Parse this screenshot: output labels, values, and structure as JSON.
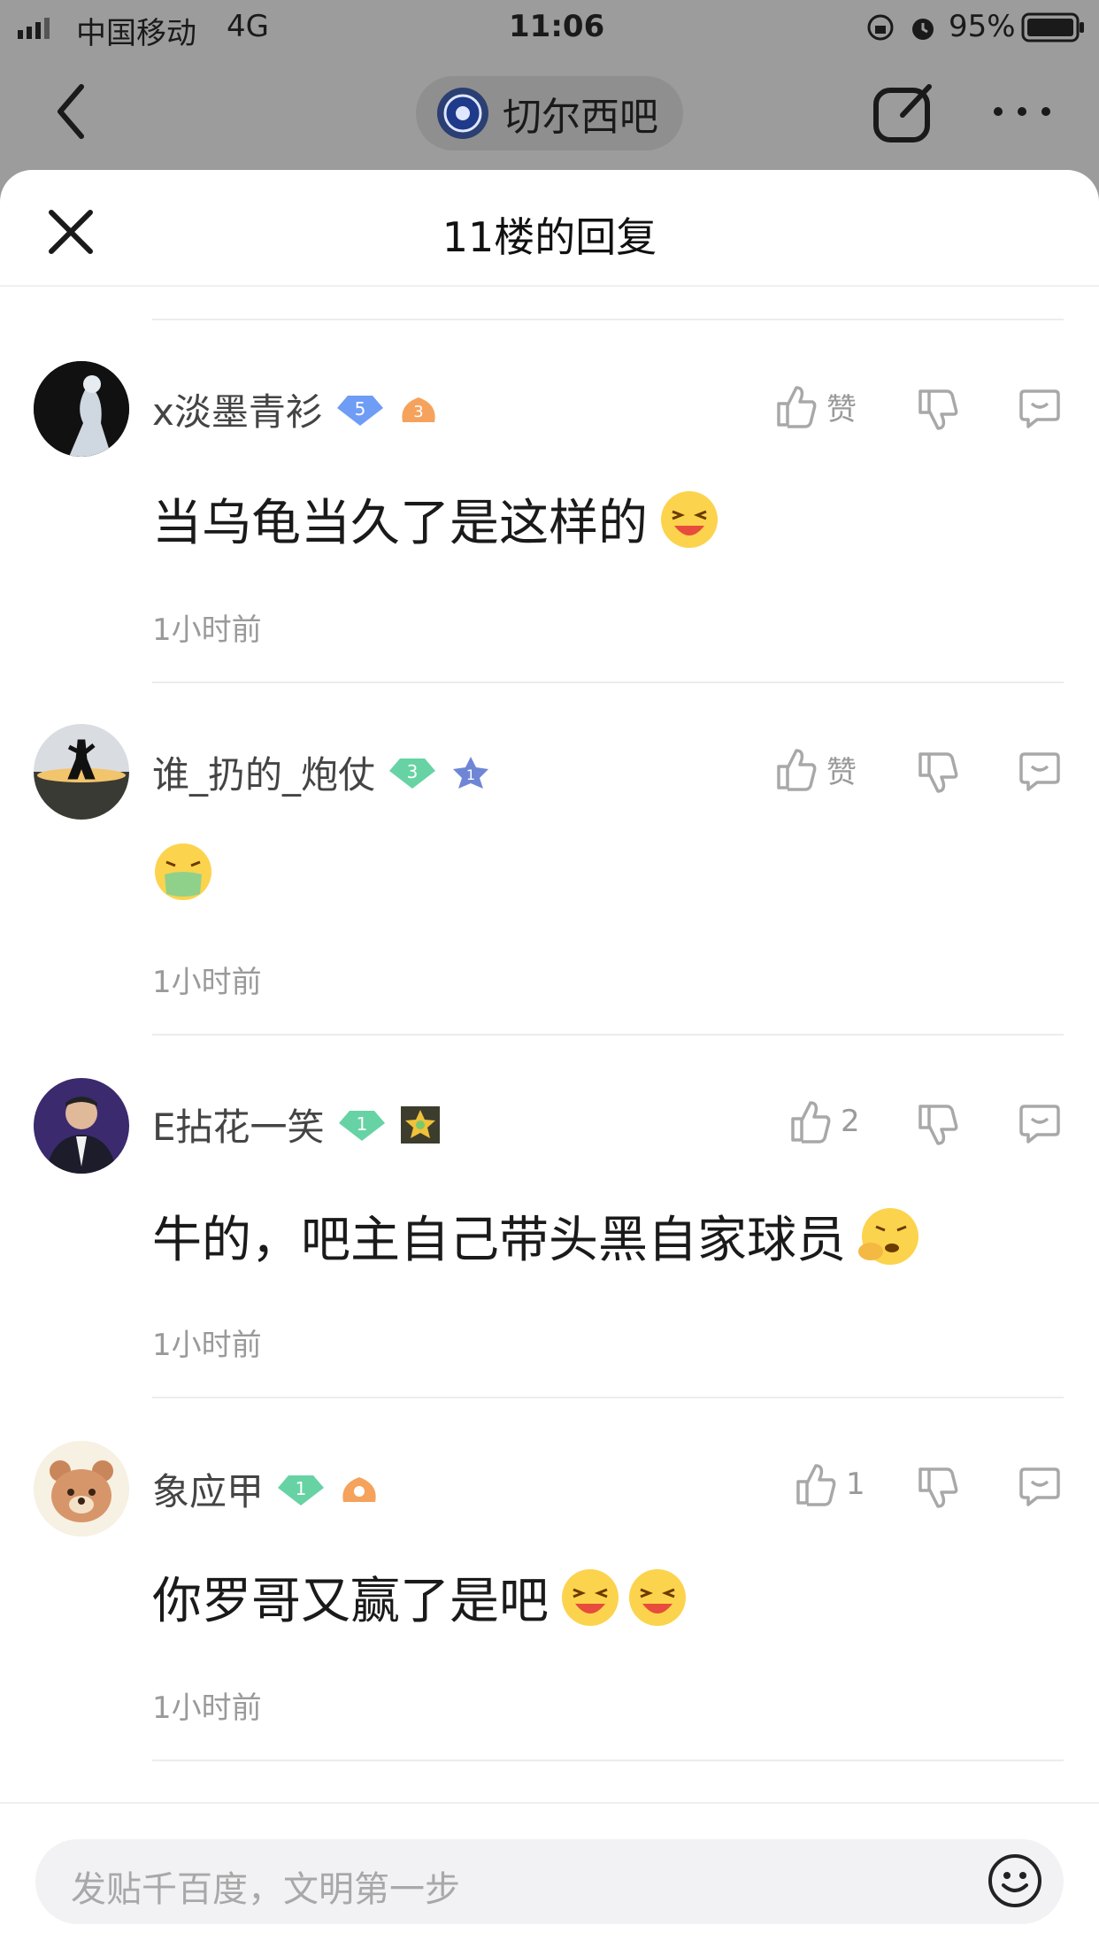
{
  "status_bar": {
    "carrier": "中国移动",
    "network": "4G",
    "time": "11:06",
    "battery": "95%"
  },
  "nav": {
    "forum_name": "切尔西吧",
    "back_icon": "back-chevron-icon",
    "edit_icon": "compose-icon",
    "more_icon": "more-icon"
  },
  "sheet": {
    "title": "11楼的回复",
    "close_icon": "close-icon"
  },
  "replies": [
    {
      "username": "x淡墨青衫",
      "level": "5",
      "honor_badge": "3",
      "content": "当乌龟当久了是这样的",
      "emoji": "laughing-emoji",
      "time": "1小时前",
      "like_label": "赞"
    },
    {
      "username": "谁_扔的_炮仗",
      "level": "3",
      "honor_badge": "1",
      "content": "",
      "emoji": "vomit-emoji",
      "time": "1小时前",
      "like_label": "赞"
    },
    {
      "username": "E拈花一笑",
      "level": "1",
      "content": "牛的，吧主自己带头黑自家球员",
      "emoji": "thinking-emoji",
      "time": "1小时前",
      "like_label": "2"
    },
    {
      "username": "象应甲",
      "level": "1",
      "content": "你罗哥又赢了是吧",
      "emoji": "laughing-emoji",
      "time": "1小时前",
      "like_label": "1"
    }
  ],
  "input": {
    "placeholder": "发贴千百度，文明第一步",
    "emoji_icon": "smiley-icon"
  },
  "colors": {
    "sheet_bg": "#ffffff",
    "overlay": "#9c9c9c",
    "level_blue": "#6f9cf5",
    "level_green": "#67d3a4"
  }
}
